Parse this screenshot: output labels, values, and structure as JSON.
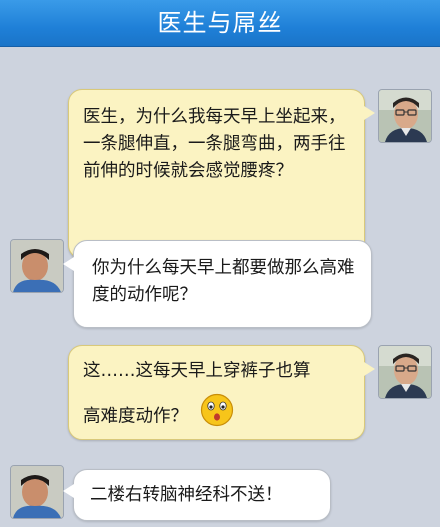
{
  "header": {
    "title": "医生与屌丝"
  },
  "messages": [
    {
      "sender": "屌丝",
      "text": "医生，为什么我每天早上坐起来，一条腿伸直，一条腿弯曲，两手往前伸的时候就会感觉腰疼？"
    },
    {
      "sender": "医生",
      "text": "你为什么每天早上都要做那么高难度的动作呢？"
    },
    {
      "sender": "屌丝",
      "line1": "这……这每天早上穿裤子也算",
      "line2": "高难度动作？",
      "emoji": "surprised-face-icon"
    },
    {
      "sender": "医生",
      "text": "二楼右转脑神经科不送！"
    }
  ],
  "colors": {
    "header": "#1f80d8",
    "background": "#cdd3de",
    "right_bubble": "#fbf3c2",
    "left_bubble": "#ffffff"
  }
}
